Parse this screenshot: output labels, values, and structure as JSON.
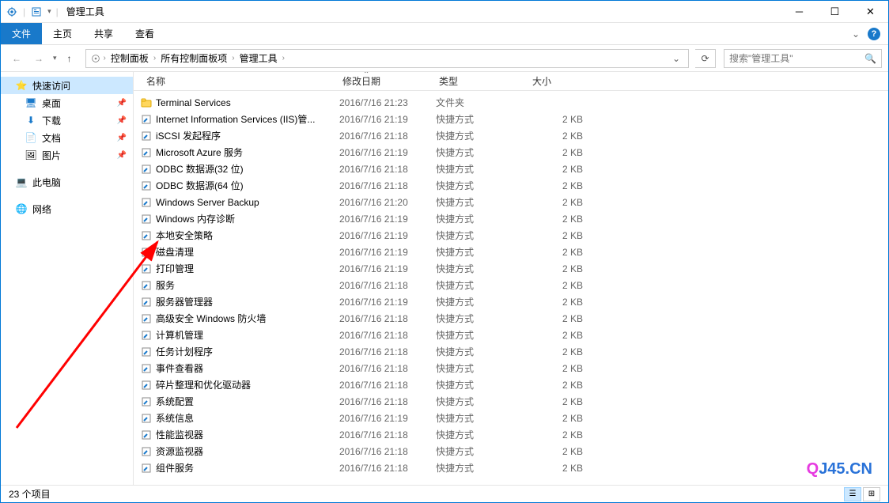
{
  "window": {
    "title": "管理工具"
  },
  "ribbon": {
    "file": "文件",
    "home": "主页",
    "share": "共享",
    "view": "查看"
  },
  "breadcrumb": {
    "items": [
      "控制面板",
      "所有控制面板项",
      "管理工具"
    ]
  },
  "search": {
    "placeholder": "搜索\"管理工具\""
  },
  "sidebar": {
    "quick_access": "快速访问",
    "desktop": "桌面",
    "downloads": "下载",
    "documents": "文档",
    "pictures": "图片",
    "this_pc": "此电脑",
    "network": "网络"
  },
  "columns": {
    "name": "名称",
    "date": "修改日期",
    "type": "类型",
    "size": "大小"
  },
  "files": [
    {
      "icon": "📁",
      "name": "Terminal Services",
      "date": "2016/7/16 21:23",
      "type": "文件夹",
      "size": ""
    },
    {
      "icon": "🔗",
      "name": "Internet Information Services (IIS)管...",
      "date": "2016/7/16 21:19",
      "type": "快捷方式",
      "size": "2 KB"
    },
    {
      "icon": "🔗",
      "name": "iSCSI 发起程序",
      "date": "2016/7/16 21:18",
      "type": "快捷方式",
      "size": "2 KB"
    },
    {
      "icon": "🔗",
      "name": "Microsoft Azure 服务",
      "date": "2016/7/16 21:19",
      "type": "快捷方式",
      "size": "2 KB"
    },
    {
      "icon": "🔗",
      "name": "ODBC 数据源(32 位)",
      "date": "2016/7/16 21:18",
      "type": "快捷方式",
      "size": "2 KB"
    },
    {
      "icon": "🔗",
      "name": "ODBC 数据源(64 位)",
      "date": "2016/7/16 21:18",
      "type": "快捷方式",
      "size": "2 KB"
    },
    {
      "icon": "🔗",
      "name": "Windows Server Backup",
      "date": "2016/7/16 21:20",
      "type": "快捷方式",
      "size": "2 KB"
    },
    {
      "icon": "🔗",
      "name": "Windows 内存诊断",
      "date": "2016/7/16 21:19",
      "type": "快捷方式",
      "size": "2 KB"
    },
    {
      "icon": "🔗",
      "name": "本地安全策略",
      "date": "2016/7/16 21:19",
      "type": "快捷方式",
      "size": "2 KB"
    },
    {
      "icon": "🔗",
      "name": "磁盘清理",
      "date": "2016/7/16 21:19",
      "type": "快捷方式",
      "size": "2 KB"
    },
    {
      "icon": "🔗",
      "name": "打印管理",
      "date": "2016/7/16 21:19",
      "type": "快捷方式",
      "size": "2 KB"
    },
    {
      "icon": "🔗",
      "name": "服务",
      "date": "2016/7/16 21:18",
      "type": "快捷方式",
      "size": "2 KB"
    },
    {
      "icon": "🔗",
      "name": "服务器管理器",
      "date": "2016/7/16 21:19",
      "type": "快捷方式",
      "size": "2 KB"
    },
    {
      "icon": "🔗",
      "name": "高级安全 Windows 防火墙",
      "date": "2016/7/16 21:18",
      "type": "快捷方式",
      "size": "2 KB"
    },
    {
      "icon": "🔗",
      "name": "计算机管理",
      "date": "2016/7/16 21:18",
      "type": "快捷方式",
      "size": "2 KB"
    },
    {
      "icon": "🔗",
      "name": "任务计划程序",
      "date": "2016/7/16 21:18",
      "type": "快捷方式",
      "size": "2 KB"
    },
    {
      "icon": "🔗",
      "name": "事件查看器",
      "date": "2016/7/16 21:18",
      "type": "快捷方式",
      "size": "2 KB"
    },
    {
      "icon": "🔗",
      "name": "碎片整理和优化驱动器",
      "date": "2016/7/16 21:18",
      "type": "快捷方式",
      "size": "2 KB"
    },
    {
      "icon": "🔗",
      "name": "系统配置",
      "date": "2016/7/16 21:18",
      "type": "快捷方式",
      "size": "2 KB"
    },
    {
      "icon": "🔗",
      "name": "系统信息",
      "date": "2016/7/16 21:19",
      "type": "快捷方式",
      "size": "2 KB"
    },
    {
      "icon": "🔗",
      "name": "性能监视器",
      "date": "2016/7/16 21:18",
      "type": "快捷方式",
      "size": "2 KB"
    },
    {
      "icon": "🔗",
      "name": "资源监视器",
      "date": "2016/7/16 21:18",
      "type": "快捷方式",
      "size": "2 KB"
    },
    {
      "icon": "🔗",
      "name": "组件服务",
      "date": "2016/7/16 21:18",
      "type": "快捷方式",
      "size": "2 KB"
    }
  ],
  "status": {
    "count": "23 个项目"
  },
  "watermark": {
    "q": "Q",
    "rest": "J45.CN"
  }
}
